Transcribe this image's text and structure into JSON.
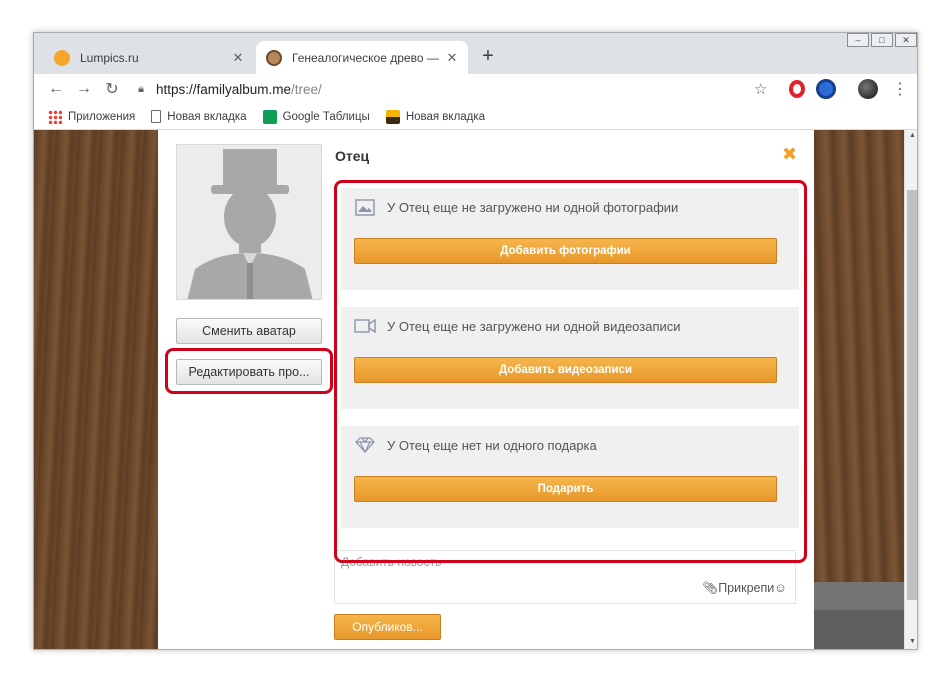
{
  "browser": {
    "tabs": [
      {
        "title": "Lumpics.ru",
        "active": false
      },
      {
        "title": "Генеалогическое древо — Семейный альбом",
        "active": true
      }
    ],
    "new_tab": "+",
    "tab_close": "✕",
    "url_host": "https://familyalbum.me",
    "url_path": "/tree/",
    "bookmarks": [
      "Приложения",
      "Новая вкладка",
      "Google Таблицы",
      "Новая вкладка"
    ]
  },
  "profile": {
    "title": "Отец",
    "change_avatar": "Сменить аватар",
    "edit_profile": "Редактировать про..."
  },
  "sections": [
    {
      "icon": "photo-icon",
      "text": "У Отец еще не загружено ни одной фотографии",
      "button": "Добавить фотографии"
    },
    {
      "icon": "video-icon",
      "text": "У Отец еще не загружено ни одной видеозаписи",
      "button": "Добавить видеозаписи"
    },
    {
      "icon": "diamond-icon",
      "text": "У Отец еще нет ни одного подарка",
      "button": "Подарить"
    }
  ],
  "comment": {
    "placeholder": "Добавить новость",
    "attach": "Прикрепи"
  },
  "publish": "Опубликов...",
  "colors": {
    "accent_orange": "#f0a030",
    "highlight_red": "#d0021b"
  }
}
